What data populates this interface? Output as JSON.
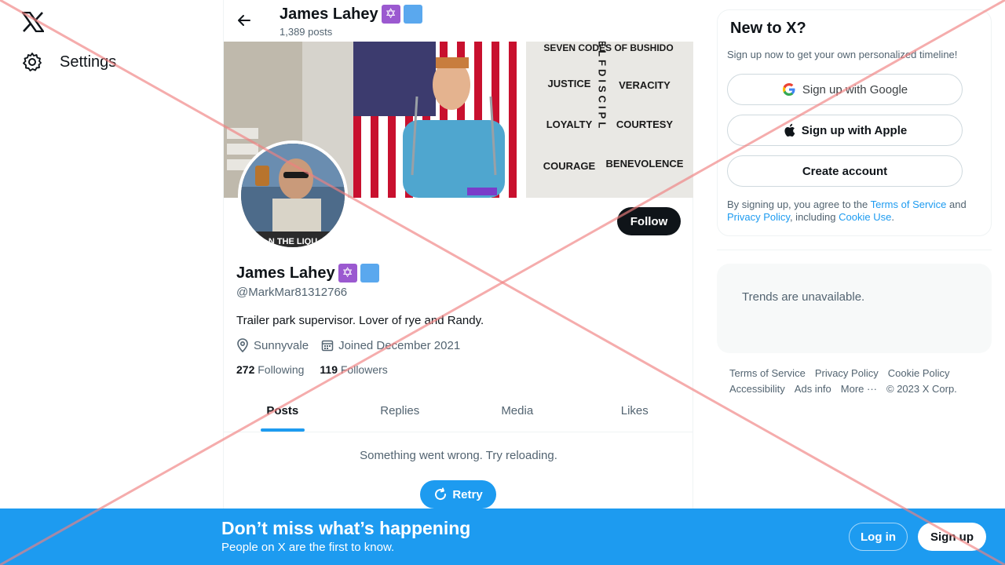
{
  "nav": {
    "settings_label": "Settings"
  },
  "header": {
    "name": "James Lahey",
    "posts_count": "1,389 posts"
  },
  "banner": {
    "codes_title": "SEVEN CODES OF BUSHIDO",
    "codes_left": [
      "JUSTICE",
      "LOYALTY",
      "COURAGE"
    ],
    "codes_right": [
      "VERACITY",
      "COURTESY",
      "BENEVOLENCE"
    ],
    "center_word": "SELFDISCIPL"
  },
  "avatar": {
    "caption": "N THE LIQU"
  },
  "profile": {
    "follow_label": "Follow",
    "name": "James Lahey",
    "handle": "@MarkMar81312766",
    "bio": "Trailer park supervisor. Lover of rye and Randy.",
    "location": "Sunnyvale",
    "joined": "Joined December 2021",
    "following_count": "272",
    "following_label": "Following",
    "followers_count": "119",
    "followers_label": "Followers"
  },
  "tabs": [
    {
      "label": "Posts",
      "active": true
    },
    {
      "label": "Replies"
    },
    {
      "label": "Media"
    },
    {
      "label": "Likes"
    }
  ],
  "feed": {
    "error_message": "Something went wrong. Try reloading.",
    "retry_label": "Retry"
  },
  "signup_card": {
    "title": "New to X?",
    "subtitle": "Sign up now to get your own personalized timeline!",
    "google_label": "Sign up with Google",
    "apple_label": "Sign up with Apple",
    "create_label": "Create account",
    "legal_prefix": "By signing up, you agree to the ",
    "terms_link": "Terms of Service",
    "legal_and": " and ",
    "privacy_link": "Privacy Policy",
    "legal_including": ", including ",
    "cookie_link": "Cookie Use",
    "legal_end": "."
  },
  "trends": {
    "message": "Trends are unavailable."
  },
  "footer": {
    "terms": "Terms of Service",
    "privacy": "Privacy Policy",
    "cookie": "Cookie Policy",
    "accessibility": "Accessibility",
    "ads_info": "Ads info",
    "more": "More ···",
    "copyright": "© 2023 X Corp."
  },
  "bottom_banner": {
    "title": "Don’t miss what’s happening",
    "subtitle": "People on X are the first to know.",
    "login_label": "Log in",
    "signup_label": "Sign up"
  },
  "colors": {
    "accent": "#1d9bf0",
    "text_primary": "#0f1419",
    "text_secondary": "#536471",
    "overlay_cross": "#f08080"
  }
}
